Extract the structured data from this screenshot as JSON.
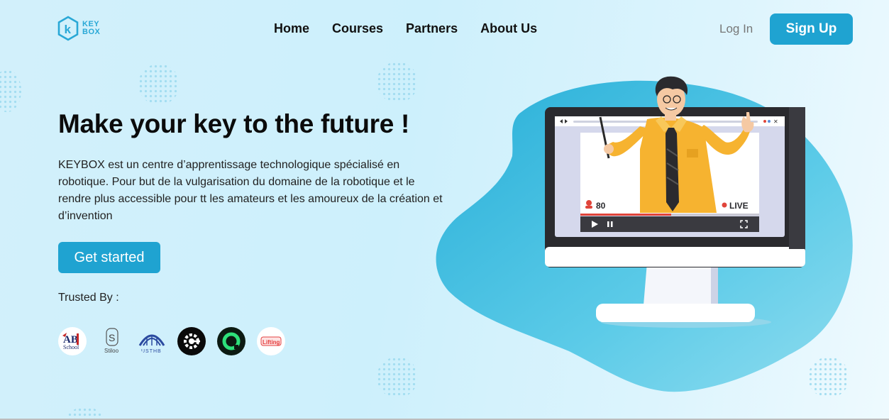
{
  "brand": {
    "line1": "KEY",
    "line2": "BOX",
    "color": "#29a8d6"
  },
  "nav": {
    "items": [
      "Home",
      "Courses",
      "Partners",
      "About Us"
    ]
  },
  "auth": {
    "login": "Log In",
    "signup": "Sign Up"
  },
  "hero": {
    "title": "Make your key to the future !",
    "description": "KEYBOX est un centre d’apprentissage technologique spécialisé en robotique. Pour but de la vulgarisation du domaine de la robotique et le rendre plus accessible pour tt les amateurs et les amoureux de la création et d’invention",
    "cta": "Get started"
  },
  "trusted": {
    "label": "Trusted By :",
    "partners": [
      {
        "name": "ab-school-logo",
        "text": "AB School"
      },
      {
        "name": "stiloo-logo",
        "text": "Stiloo"
      },
      {
        "name": "usthb-logo",
        "text": "USTHB"
      },
      {
        "name": "gear-logo",
        "text": ""
      },
      {
        "name": "ring-logo",
        "text": ""
      },
      {
        "name": "lifting-logo",
        "text": "Lifting"
      }
    ]
  },
  "video": {
    "viewers": "80",
    "live": "LIVE"
  },
  "colors": {
    "accent": "#1fa3d1",
    "blob": "#4cc3e3",
    "live": "#e0443a"
  }
}
